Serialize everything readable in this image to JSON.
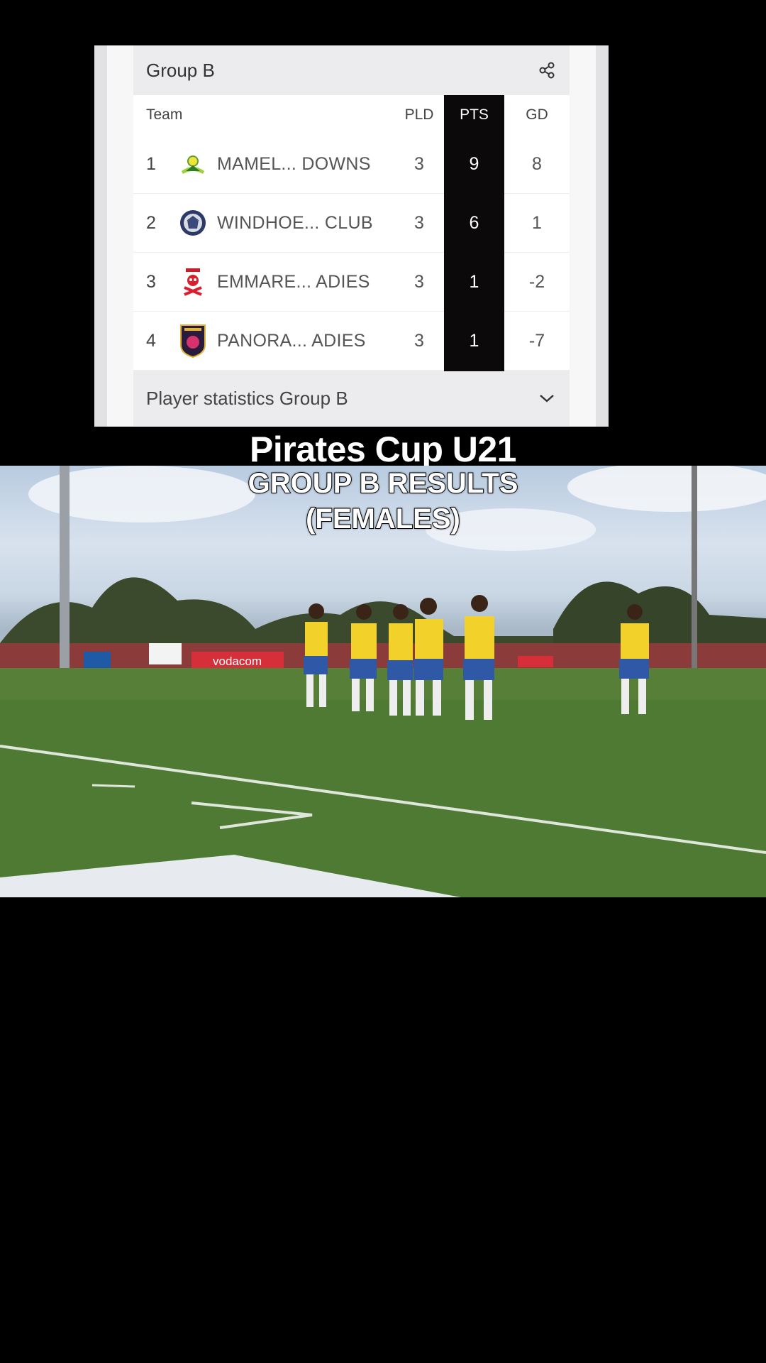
{
  "standings": {
    "group_title": "Group B",
    "headers": {
      "team": "Team",
      "pld": "PLD",
      "pts": "PTS",
      "gd": "GD"
    },
    "rows": [
      {
        "rank": "1",
        "team": "MAMEL... DOWNS",
        "pld": "3",
        "pts": "9",
        "gd": "8",
        "logo": "sundowns-logo"
      },
      {
        "rank": "2",
        "team": "WINDHOE... CLUB",
        "pld": "3",
        "pts": "6",
        "gd": "1",
        "logo": "windhoek-club-logo"
      },
      {
        "rank": "3",
        "team": "EMMARE...  ADIES",
        "pld": "3",
        "pts": "1",
        "gd": "-2",
        "logo": "pirates-skull-logo"
      },
      {
        "rank": "4",
        "team": "PANORA...  ADIES",
        "pld": "3",
        "pts": "1",
        "gd": "-7",
        "logo": "panorama-shield-logo"
      }
    ],
    "stats_label": "Player statistics Group B",
    "highlight_color": "#0b0909"
  },
  "captions": {
    "title": "Pirates Cup U21",
    "subtitle_line1": "GROUP B RESULTS",
    "subtitle_line2": "(FEMALES)"
  },
  "photo": {
    "banner_text": "vodacom"
  }
}
